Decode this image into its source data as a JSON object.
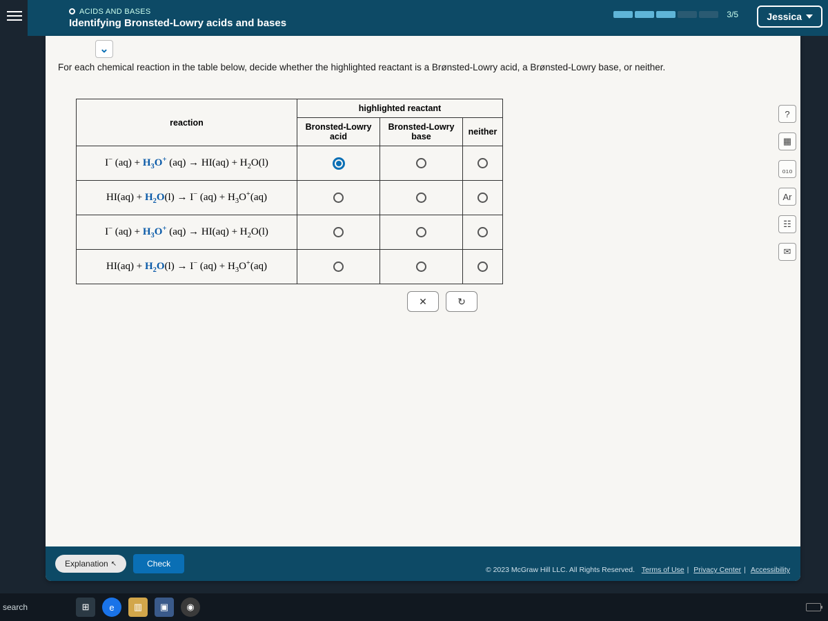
{
  "header": {
    "topic": "ACIDS AND BASES",
    "subtitle": "Identifying Bronsted-Lowry acids and bases",
    "progress_text": "3/5",
    "user": "Jessica"
  },
  "prompt": "For each chemical reaction in the table below, decide whether the highlighted reactant is a Brønsted-Lowry acid, a Brønsted-Lowry base, or neither.",
  "table": {
    "h_reaction": "reaction",
    "h_hr": "highlighted reactant",
    "h_acid": "Bronsted-Lowry acid",
    "h_base": "Bronsted-Lowry base",
    "h_neither": "neither"
  },
  "rows": [
    {
      "pre": "I⁻ (aq) + ",
      "hl": "H₃O⁺",
      "hlstate": "(aq)",
      "arrow": " → ",
      "post": "HI(aq) + H₂O(l)",
      "sel": 0
    },
    {
      "pre": "HI(aq) + ",
      "hl": "H₂O",
      "hlstate": "(l)",
      "arrow": " → ",
      "post": "I⁻ (aq) + H₃O⁺(aq)",
      "sel": -1
    },
    {
      "pre": "I⁻ (aq) + ",
      "hl": "H₃O⁺",
      "hlstate": "(aq)",
      "arrow": " → ",
      "post": "HI(aq) + H₂O(l)",
      "sel": -1
    },
    {
      "pre": "HI(aq) + ",
      "hl": "H₂O",
      "hlstate": "(l)",
      "arrow": " → ",
      "post": "I⁻ (aq) + H₃O⁺(aq)",
      "sel": -1
    }
  ],
  "actions": {
    "clear": "✕",
    "reset": "↻"
  },
  "rail": {
    "help": "?",
    "calc": "▦",
    "chart": "₀₁₀",
    "ptable": "Ar",
    "ref": "☷",
    "mail": "✉"
  },
  "footer": {
    "explanation": "Explanation",
    "check": "Check",
    "copyright": "© 2023 McGraw Hill LLC. All Rights Reserved.",
    "terms": "Terms of Use",
    "privacy": "Privacy Center",
    "access": "Accessibility"
  },
  "taskbar": {
    "search": "search"
  }
}
